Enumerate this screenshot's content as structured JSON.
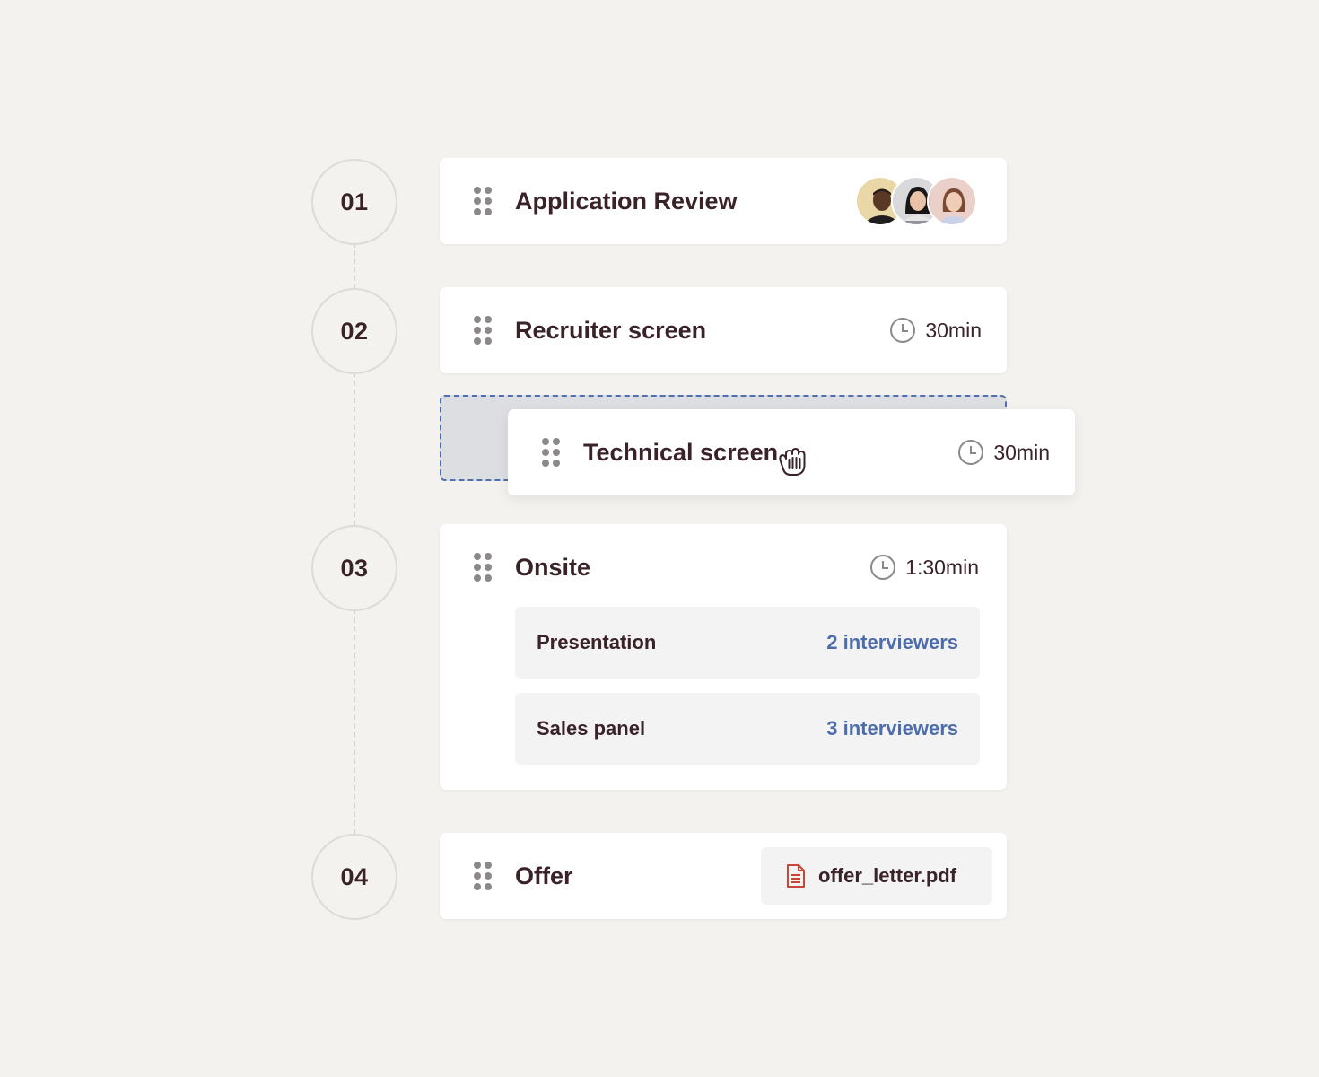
{
  "steps": [
    {
      "number": "01",
      "title": "Application Review",
      "avatars": [
        "Interviewer 1",
        "Interviewer 2",
        "Interviewer 3"
      ]
    },
    {
      "number": "02",
      "title": "Recruiter screen",
      "duration": "30min"
    },
    {
      "number": "03",
      "title": "Onsite",
      "duration": "1:30min",
      "sessions": [
        {
          "label": "Presentation",
          "interviewers": "2 interviewers"
        },
        {
          "label": "Sales panel",
          "interviewers": "3 interviewers"
        }
      ]
    },
    {
      "number": "04",
      "title": "Offer",
      "attachment": "offer_letter.pdf"
    }
  ],
  "dragging": {
    "title": "Technical screen",
    "duration": "30min"
  },
  "icons": {
    "drag": "drag-handle-icon",
    "clock": "clock-icon",
    "file": "pdf-file-icon",
    "cursor": "grab-hand-cursor-icon"
  },
  "colors": {
    "background": "#f4f2ee",
    "text": "#3a2328",
    "link": "#4c6dab",
    "drop_border": "#4f6fb0",
    "pdf": "#c8453a"
  }
}
